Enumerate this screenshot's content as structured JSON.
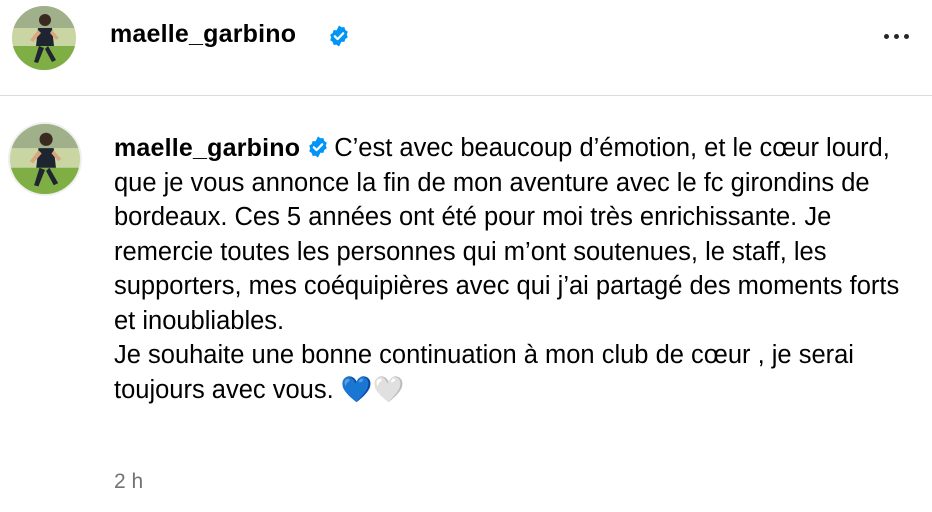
{
  "header": {
    "username": "maelle_garbino"
  },
  "post": {
    "username": "maelle_garbino",
    "caption": "C’est avec beaucoup d’émotion, et le cœur lourd, que je vous annonce la fin de mon aventure avec le fc girondins de bordeaux. Ces 5 années ont été pour moi très enrichissante. Je remercie toutes les personnes qui m’ont soutenues, le staff, les supporters, mes coéquipières avec qui j’ai partagé des moments forts et inoubliables.\nJe souhaite une bonne continuation à mon club de cœur , je serai toujours avec vous. 💙🤍",
    "timestamp": "2 h"
  },
  "icons": {
    "verified": "verified-badge-icon",
    "more": "more-options-icon"
  },
  "colors": {
    "verified_blue": "#0095f6",
    "divider": "#dbdbdb",
    "secondary_text": "#737373"
  }
}
